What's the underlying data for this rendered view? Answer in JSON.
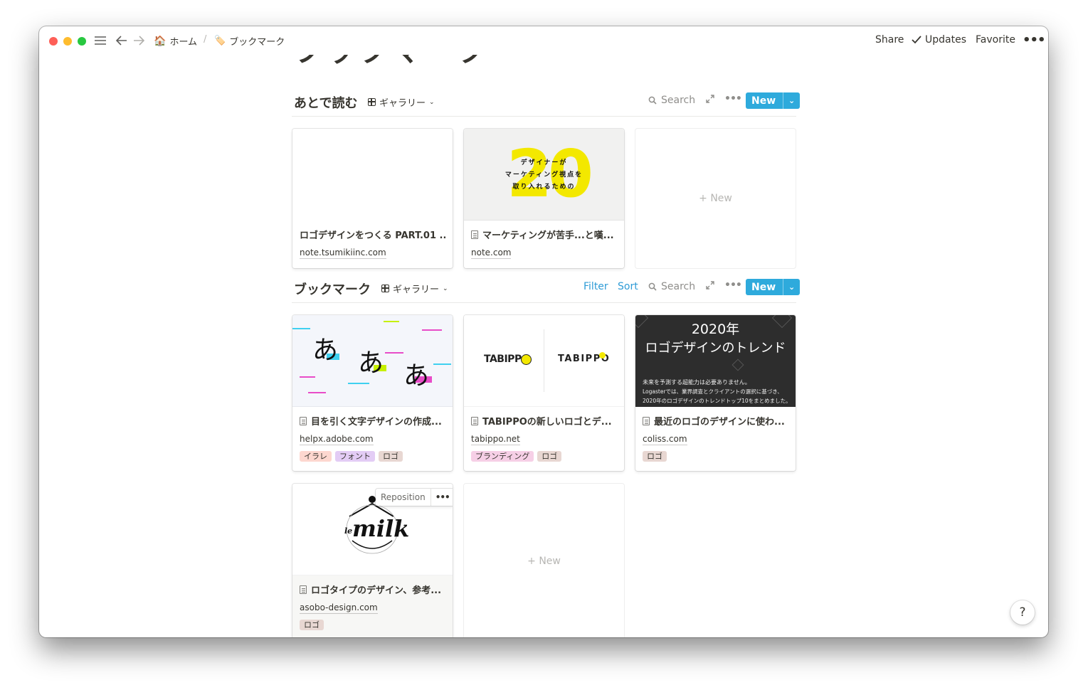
{
  "topbar": {
    "breadcrumb": [
      {
        "icon": "house-emoji",
        "label": "ホーム"
      },
      {
        "icon": "bookmark-tag-emoji",
        "label": "ブックマーク"
      }
    ],
    "separator": "/",
    "share_label": "Share",
    "updates_label": "Updates",
    "favorite_label": "Favorite"
  },
  "page": {
    "title": "ブックマーク"
  },
  "sections": [
    {
      "title": "あとで読む",
      "view_label": "ギャラリー",
      "tools": {
        "search_label": "Search",
        "new_label": "New"
      },
      "cards": [
        {
          "title": "ロゴデザインをつくる PART.01 ...",
          "url": "note.tsumikiinc.com",
          "has_doc_icon": false
        },
        {
          "title": "マーケティングが苦手...と嘆...",
          "url": "note.com",
          "has_doc_icon": true,
          "cover_text": {
            "number": "20",
            "line1": "デザイナーが",
            "line2": "マーケティング視点を",
            "line3": "取り入れるための"
          }
        }
      ],
      "new_card_label": "New"
    },
    {
      "title": "ブックマーク",
      "view_label": "ギャラリー",
      "tools": {
        "filter_label": "Filter",
        "sort_label": "Sort",
        "search_label": "Search",
        "new_label": "New"
      },
      "cards": [
        {
          "title": "目を引く文字デザインの作成...",
          "url": "helpx.adobe.com",
          "tags": [
            {
              "label": "イラレ",
              "color": "#fdd7cf"
            },
            {
              "label": "フォント",
              "color": "#e3ccf5"
            },
            {
              "label": "ロゴ",
              "color": "#e8d7d2"
            }
          ],
          "cover_text": {
            "glyph": "あ"
          }
        },
        {
          "title": "TABIPPOの新しいロゴとデ...",
          "url": "tabippo.net",
          "tags": [
            {
              "label": "ブランディング",
              "color": "#f6cfe6"
            },
            {
              "label": "ロゴ",
              "color": "#e8d7d2"
            }
          ],
          "cover_text": {
            "logo_a": "TABIPPO",
            "logo_b": "TABIPPO"
          }
        },
        {
          "title": "最近のロゴのデザインに使わ...",
          "url": "coliss.com",
          "tags": [
            {
              "label": "ロゴ",
              "color": "#e8d7d2"
            }
          ],
          "cover_text": {
            "line1": "2020年",
            "line2": "ロゴデザインのトレンド",
            "small1": "未来を予測する超能力は必要ありません。",
            "small2": "Logasterでは、業界調査とクライアントの選択に基づき、",
            "small3": "2020年のロゴデザインのトレンドトップ10をまとめました。"
          }
        },
        {
          "title": "ロゴタイプのデザイン、参考...",
          "url": "asobo-design.com",
          "tags": [
            {
              "label": "ロゴ",
              "color": "#e8d7d2"
            }
          ],
          "reposition_label": "Reposition",
          "cover_text": {
            "logo": "milk",
            "prefix": "le"
          }
        }
      ],
      "new_card_label": "New"
    }
  ],
  "colors": {
    "accent": "#2eaadc",
    "link_blue": "#2e9bd6",
    "yellow": "#f3e800"
  },
  "help_label": "?"
}
